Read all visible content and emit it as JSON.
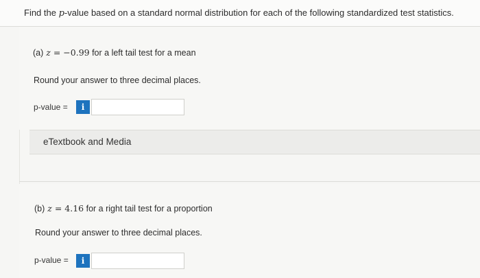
{
  "question": {
    "prefix": "Find the ",
    "pvar": "p",
    "suffix": "-value based on a standard normal distribution for each of the following standardized test statistics."
  },
  "part_a": {
    "label": "(a)",
    "z_var": "z",
    "equals": " = ",
    "z_value": "−0.99",
    "description": " for a left tail test for a mean",
    "round_text": "Round your answer to three decimal places.",
    "pvalue_label": "p-value =",
    "info_icon_glyph": "i",
    "input_value": ""
  },
  "etextbook": {
    "label": "eTextbook and Media"
  },
  "part_b": {
    "label": "(b)",
    "z_var": "z",
    "equals": " = ",
    "z_value": "4.16",
    "description": " for a right tail test for a proportion",
    "round_text": "Round your answer to three decimal places.",
    "pvalue_label": "p-value =",
    "info_icon_glyph": "i",
    "input_value": ""
  },
  "colors": {
    "info_button": "#1e73be",
    "background": "#f6f6f4"
  }
}
